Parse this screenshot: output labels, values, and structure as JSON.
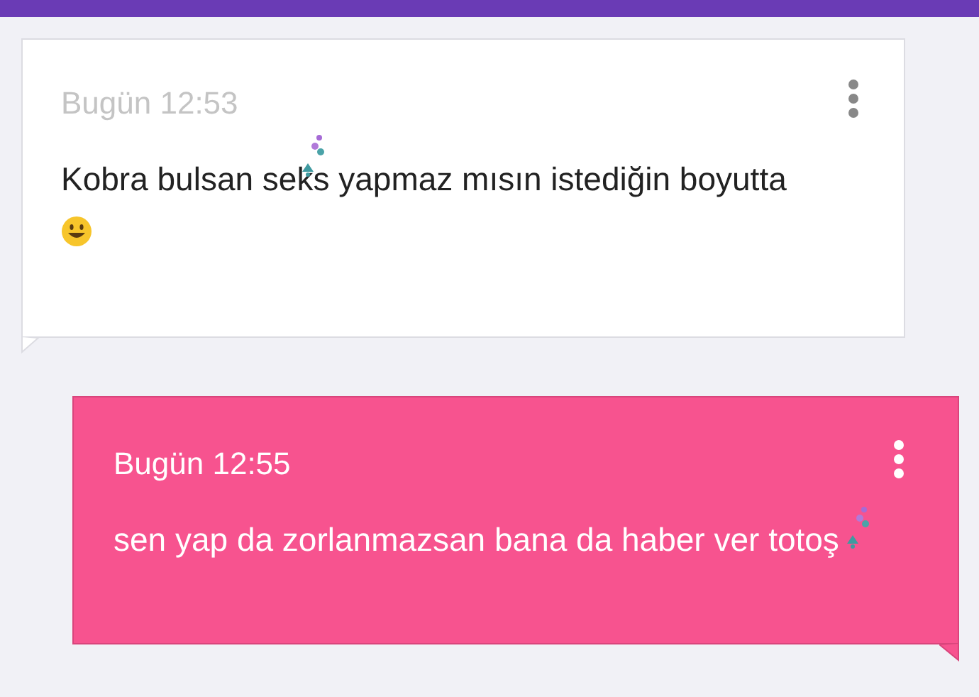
{
  "messages": [
    {
      "kind": "incoming",
      "time": "Bugün 12:53",
      "text": "Kobra bulsan seks yapmaz mısın istediğin boyutta",
      "emoji": true
    },
    {
      "kind": "outgoing",
      "time": "Bugün 12:55",
      "text": "sen yap da zorlanmazsan bana da haber ver totoş",
      "emoji": false
    }
  ]
}
